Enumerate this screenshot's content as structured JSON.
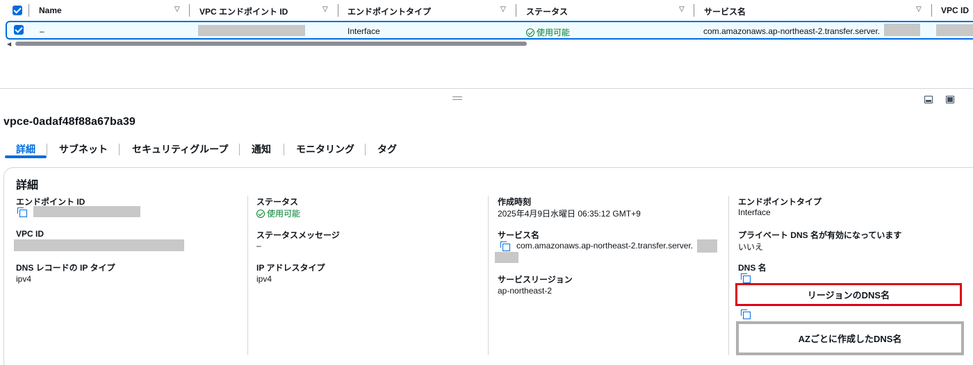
{
  "table": {
    "columns": [
      "Name",
      "VPC エンドポイント ID",
      "エンドポイントタイプ",
      "ステータス",
      "サービス名",
      "VPC ID"
    ],
    "row": {
      "name": "–",
      "endpoint_type": "Interface",
      "status": "使用可能",
      "service_name": "com.amazonaws.ap-northeast-2.transfer.server."
    }
  },
  "detail": {
    "resource_id": "vpce-0adaf48f88a67ba39",
    "tabs": [
      "詳細",
      "サブネット",
      "セキュリティグループ",
      "通知",
      "モニタリング",
      "タグ"
    ],
    "section_title": "詳細",
    "fields": {
      "endpoint_id_label": "エンドポイント ID",
      "vpc_id_label": "VPC ID",
      "dns_record_ip_type_label": "DNS レコードの IP タイプ",
      "dns_record_ip_type": "ipv4",
      "status_label": "ステータス",
      "status": "使用可能",
      "status_message_label": "ステータスメッセージ",
      "status_message": "–",
      "ip_address_type_label": "IP アドレスタイプ",
      "ip_address_type": "ipv4",
      "created_label": "作成時刻",
      "created": "2025年4月9日水曜日 06:35:12 GMT+9",
      "service_name_label": "サービス名",
      "service_name": "com.amazonaws.ap-northeast-2.transfer.server.",
      "service_region_label": "サービスリージョン",
      "service_region": "ap-northeast-2",
      "endpoint_type_label": "エンドポイントタイプ",
      "endpoint_type": "Interface",
      "private_dns_label": "プライベート DNS 名が有効になっています",
      "private_dns": "いいえ",
      "dns_name_label": "DNS 名"
    }
  },
  "annotations": {
    "regional_dns": "リージョンのDNS名",
    "az_dns": "AZごとに作成したDNS名"
  },
  "colors": {
    "accent": "#006ce0",
    "success": "#00802f",
    "annotation_red": "#e0001a",
    "annotation_gray": "#b0b0b0",
    "redaction": "#c8c8c8"
  }
}
